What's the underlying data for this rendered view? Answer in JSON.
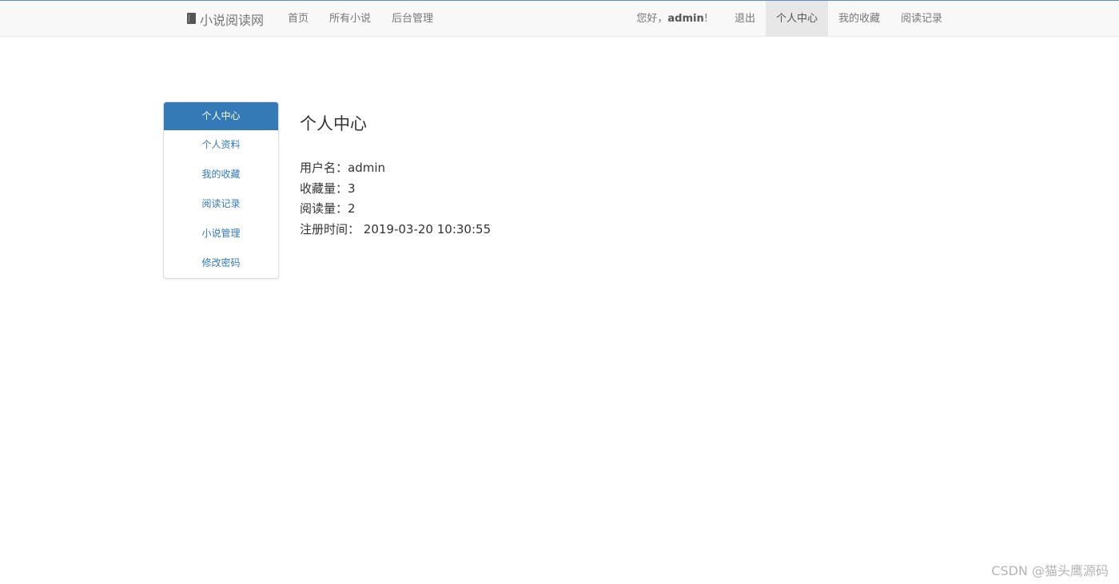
{
  "navbar": {
    "brand": "小说阅读网",
    "left_items": [
      {
        "label": "首页"
      },
      {
        "label": "所有小说"
      },
      {
        "label": "后台管理"
      }
    ],
    "greeting_prefix": "您好，",
    "username": "admin",
    "greeting_suffix": "!",
    "right_items": [
      {
        "label": "退出"
      },
      {
        "label": "个人中心"
      },
      {
        "label": "我的收藏"
      },
      {
        "label": "阅读记录"
      }
    ]
  },
  "sidebar": {
    "items": [
      {
        "label": "个人中心"
      },
      {
        "label": "个人资料"
      },
      {
        "label": "我的收藏"
      },
      {
        "label": "阅读记录"
      },
      {
        "label": "小说管理"
      },
      {
        "label": "修改密码"
      }
    ]
  },
  "main": {
    "title": "个人中心",
    "username_label": "用户名：",
    "username_value": "admin",
    "favorites_label": "收藏量：",
    "favorites_value": "3",
    "reads_label": "阅读量：",
    "reads_value": "2",
    "registered_label": "注册时间：",
    "registered_value": "2019-03-20 10:30:55"
  },
  "watermark": "CSDN @猫头鹰源码",
  "colors": {
    "accent": "#337ab7",
    "navbar_bg": "#f8f8f8",
    "nav_active_bg": "#e7e7e7"
  }
}
